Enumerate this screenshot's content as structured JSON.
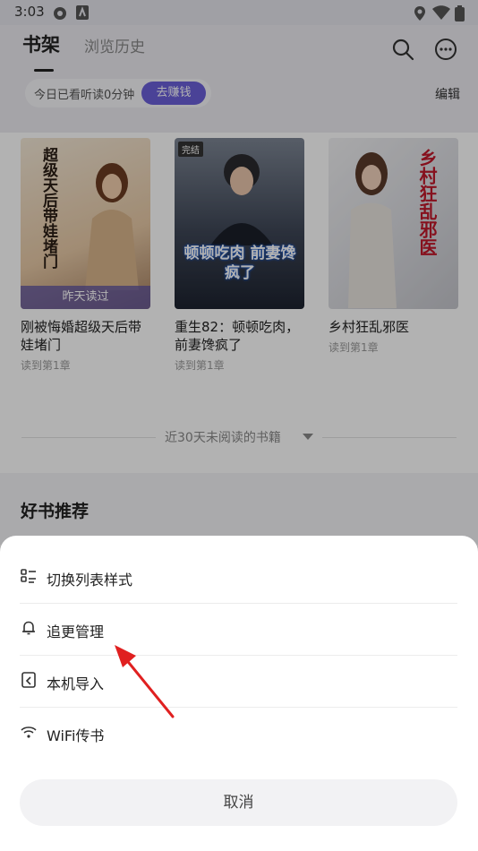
{
  "status_bar": {
    "time": "3:03"
  },
  "header": {
    "tab_active": "书架",
    "tab_history": "浏览历史",
    "reading_time": "今日已看听读0分钟",
    "earn_button": "去赚钱",
    "edit": "编辑"
  },
  "books": [
    {
      "title": "刚被悔婚超级天后带娃堵门",
      "progress": "读到第1章",
      "cover_text": "超级天后带娃堵门",
      "badge": "昨天读过"
    },
    {
      "title": "重生82：顿顿吃肉，前妻馋疯了",
      "progress": "读到第1章",
      "cover_text": "顿顿吃肉 前妻馋疯了",
      "badge": "完结"
    },
    {
      "title": "乡村狂乱邪医",
      "progress": "读到第1章",
      "cover_text": "乡村狂乱邪医"
    }
  ],
  "shelf_divider": "近30天未阅读的书籍",
  "recommend_title": "好书推荐",
  "menu": {
    "items": [
      {
        "label": "切换列表样式",
        "icon": "list-style-icon"
      },
      {
        "label": "追更管理",
        "icon": "bell-icon"
      },
      {
        "label": "本机导入",
        "icon": "import-icon"
      },
      {
        "label": "WiFi传书",
        "icon": "wifi-icon"
      }
    ],
    "cancel": "取消"
  },
  "colors": {
    "accent": "#6a5fd8",
    "arrow": "#e02020"
  }
}
